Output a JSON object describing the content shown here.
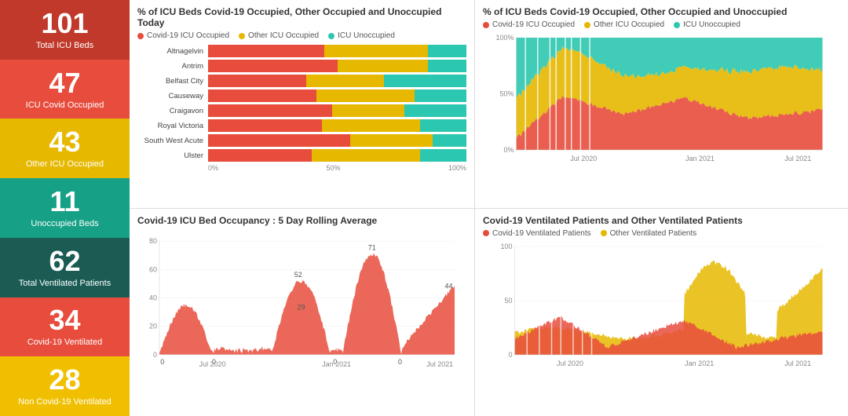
{
  "sidebar": {
    "stats": [
      {
        "id": "total-icu",
        "number": "101",
        "label": "Total ICU Beds",
        "class": "stat-red"
      },
      {
        "id": "icu-covid",
        "number": "47",
        "label": "ICU Covid Occupied",
        "class": "stat-coral"
      },
      {
        "id": "other-icu",
        "number": "43",
        "label": "Other ICU Occupied",
        "class": "stat-gold"
      },
      {
        "id": "unoccupied",
        "number": "11",
        "label": "Unoccupied Beds",
        "class": "stat-teal"
      },
      {
        "id": "total-vent",
        "number": "62",
        "label": "Total Ventilated Patients",
        "class": "stat-dark-teal"
      },
      {
        "id": "covid-vent",
        "number": "34",
        "label": "Covid-19 Ventilated",
        "class": "stat-coral"
      },
      {
        "id": "non-covid-vent",
        "number": "28",
        "label": "Non Covid-19 Ventilated",
        "class": "stat-light-gold"
      }
    ]
  },
  "bar_chart": {
    "title": "% of ICU Beds Covid-19 Occupied, Other Occupied and Unoccupied Today",
    "legend": [
      {
        "label": "Covid-19 ICU Occupied",
        "color": "#e74c3c"
      },
      {
        "label": "Other ICU Occupied",
        "color": "#e6b800"
      },
      {
        "label": "ICU Unoccupied",
        "color": "#2cc7b0"
      }
    ],
    "rows": [
      {
        "label": "Altnagelvin",
        "red": 45,
        "gold": 40,
        "teal": 15
      },
      {
        "label": "Antrim",
        "red": 50,
        "gold": 35,
        "teal": 15
      },
      {
        "label": "Belfast City",
        "red": 38,
        "gold": 30,
        "teal": 32
      },
      {
        "label": "Causeway",
        "red": 42,
        "gold": 38,
        "teal": 20
      },
      {
        "label": "Craigavon",
        "red": 48,
        "gold": 28,
        "teal": 24
      },
      {
        "label": "Royal Victoria",
        "red": 44,
        "gold": 38,
        "teal": 18
      },
      {
        "label": "South West Acute",
        "red": 55,
        "gold": 32,
        "teal": 13
      },
      {
        "label": "Ulster",
        "red": 40,
        "gold": 42,
        "teal": 18
      }
    ],
    "axis": [
      "0%",
      "50%",
      "100%"
    ]
  },
  "rolling_chart": {
    "title": "Covid-19 ICU Bed Occupancy : 5 Day Rolling Average",
    "y_max": 80,
    "annotations": [
      {
        "x_label": "Jul 2020",
        "value": 0
      },
      {
        "x_label": "",
        "value": 52
      },
      {
        "x_label": "Jan 2021",
        "value": 29
      },
      {
        "x_label": "",
        "value": 71
      },
      {
        "x_label": "Jul 2021",
        "value": 44
      }
    ]
  },
  "top_right_chart": {
    "title": "% of ICU Beds Covid-19 Occupied, Other Occupied and Unoccupied",
    "legend": [
      {
        "label": "Covid-19 ICU Occupied",
        "color": "#e74c3c"
      },
      {
        "label": "Other ICU Occupied",
        "color": "#e6b800"
      },
      {
        "label": "ICU Unoccupied",
        "color": "#2cc7b0"
      }
    ],
    "y_labels": [
      "0%",
      "50%",
      "100%"
    ],
    "x_labels": [
      "Jul 2020",
      "Jan 2021",
      "Jul 2021"
    ]
  },
  "bottom_right_chart": {
    "title": "Covid-19 Ventilated Patients and Other Ventilated Patients",
    "legend": [
      {
        "label": "Covid-19 Ventilated Patients",
        "color": "#e74c3c"
      },
      {
        "label": "Other Ventilated Patients",
        "color": "#e6b800"
      }
    ],
    "y_max": 100,
    "y_labels": [
      "0",
      "50",
      "100"
    ],
    "x_labels": [
      "Jul 2020",
      "Jan 2021",
      "Jul 2021"
    ]
  }
}
